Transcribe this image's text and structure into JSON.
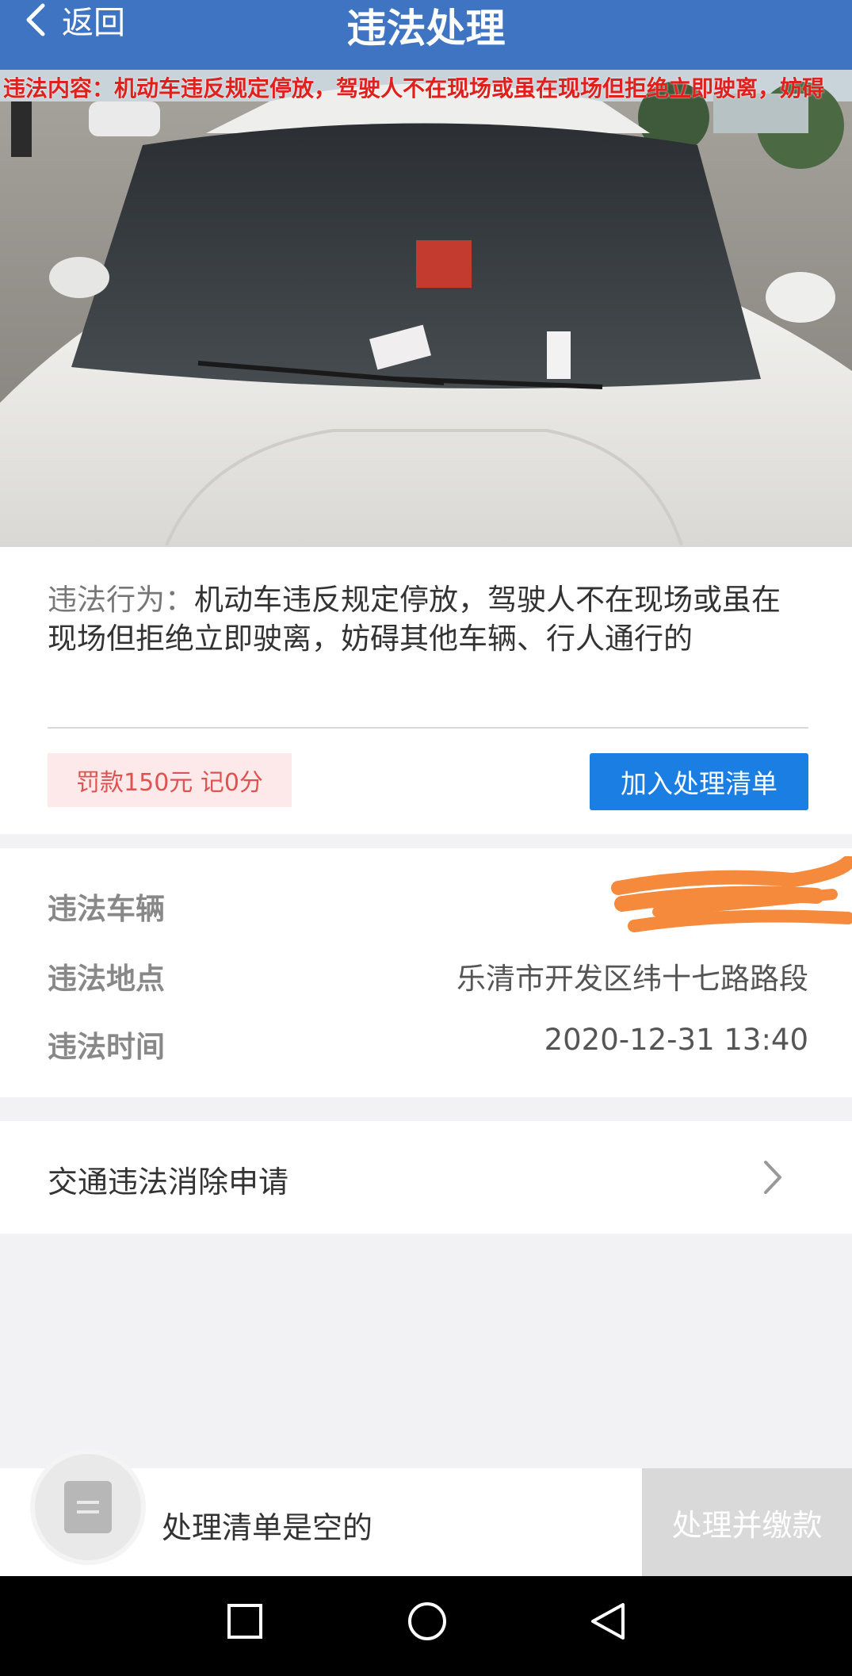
{
  "header": {
    "back_label": "返回",
    "title": "违法处理"
  },
  "photo": {
    "overlay_text": "违法内容：机动车违反规定停放，驾驶人不在现场或虽在现场但拒绝立即驶离，妨碍"
  },
  "violation": {
    "behavior_label": "违法行为：",
    "behavior_text": "机动车违反规定停放，驾驶人不在现场或虽在现场但拒绝立即驶离，妨碍其他车辆、行人通行的",
    "fine_badge": "罚款150元 记0分",
    "add_button": "加入处理清单"
  },
  "details": {
    "vehicle_label": "违法车辆",
    "vehicle_value": "",
    "location_label": "违法地点",
    "location_value": "乐清市开发区纬十七路路段",
    "time_label": "违法时间",
    "time_value": "2020-12-31 13:40"
  },
  "elimination": {
    "label": "交通违法消除申请"
  },
  "bottom_bar": {
    "empty_text": "处理清单是空的",
    "pay_button": "处理并缴款"
  },
  "colors": {
    "header_blue": "#3f74c2",
    "button_blue": "#1a7ee3",
    "fine_red": "#e0524f",
    "redact_orange": "#f58a3c"
  }
}
